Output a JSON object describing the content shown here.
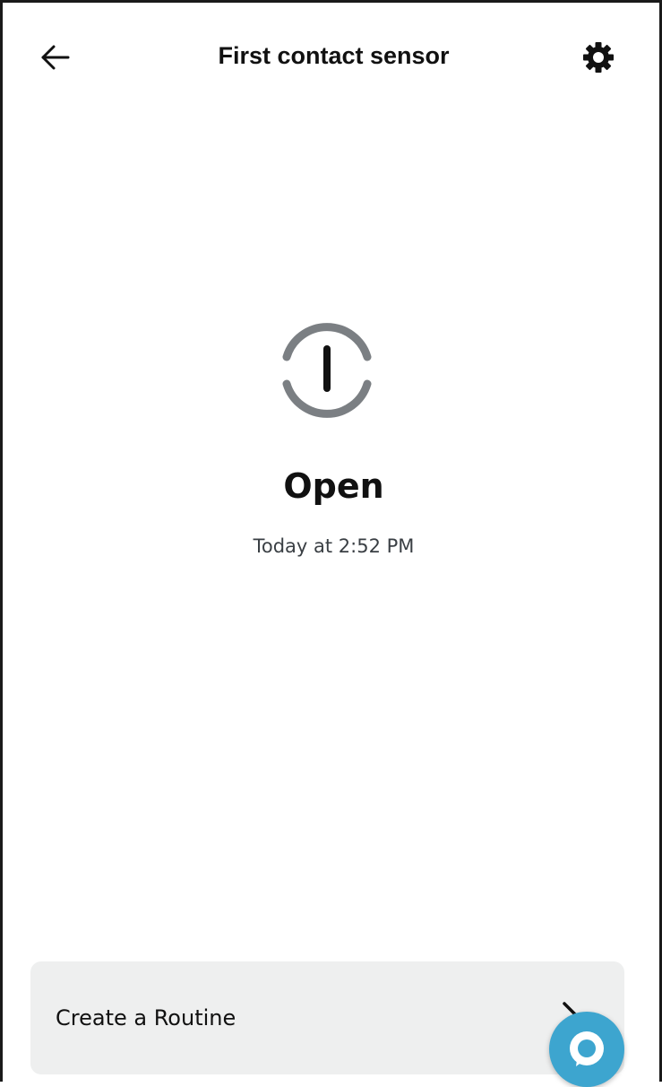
{
  "header": {
    "title": "First contact sensor",
    "back_icon": "arrow-left-icon",
    "settings_icon": "gear-icon"
  },
  "status": {
    "icon": "contact-sensor-open-icon",
    "label": "Open",
    "timestamp": "Today at 2:52 PM"
  },
  "routine_card": {
    "label": "Create a Routine",
    "chevron_icon": "chevron-right-icon"
  },
  "alexa_button": {
    "icon": "alexa-icon"
  },
  "colors": {
    "accent": "#3da5cf",
    "icon_gray": "#7b7f83",
    "card_background": "#eeefef",
    "text_primary": "#111111",
    "text_secondary": "#3a3f44"
  }
}
